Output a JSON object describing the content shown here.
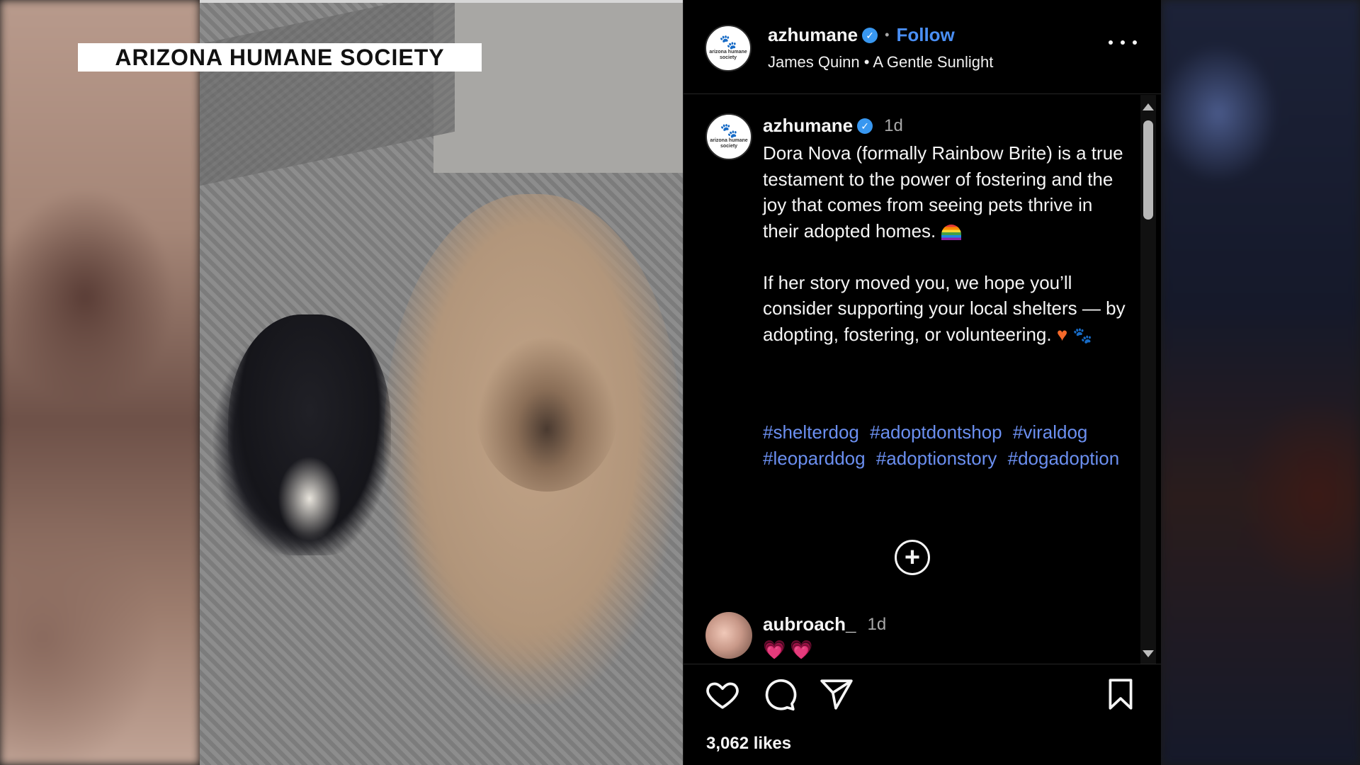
{
  "overlay": {
    "caption": "ARIZONA HUMANE SOCIETY"
  },
  "header": {
    "username": "azhumane",
    "verified_icon": "verified-badge-icon",
    "separator": "•",
    "follow_label": "Follow",
    "subtitle": "James Quinn • A Gentle Sunlight",
    "avatar_paw": "🐾",
    "avatar_logo_text": "arizona humane society"
  },
  "post": {
    "username": "azhumane",
    "time": "1d",
    "caption_paragraph_1": "Dora Nova (formally Rainbow Brite) is a true testament to the power of fostering and the joy that comes from seeing pets thrive in their adopted homes.",
    "caption_paragraph_2": "If her story moved you, we hope you’ll consider supporting your local shelters — by adopting, fostering, or volunteering.",
    "hashtags": [
      "#shelterdog",
      "#adoptdontshop",
      "#viraldog",
      "#leoparddog",
      "#adoptionstory",
      "#dogadoption"
    ]
  },
  "comment": {
    "username": "aubroach_",
    "time": "1d",
    "text": "💗💗"
  },
  "actions": {
    "likes": "3,062 likes"
  },
  "icons": {
    "more": "more-options-icon",
    "add": "add-circle-icon",
    "like": "heart-icon",
    "comment": "comment-bubble-icon",
    "share": "paper-plane-icon",
    "save": "bookmark-icon"
  },
  "colors": {
    "panel_bg": "#000000",
    "link_blue": "#4a8ff5",
    "hashtag_blue": "#6b8ff0",
    "verified_blue": "#3897f0",
    "muted_text": "#a8a8a8"
  }
}
